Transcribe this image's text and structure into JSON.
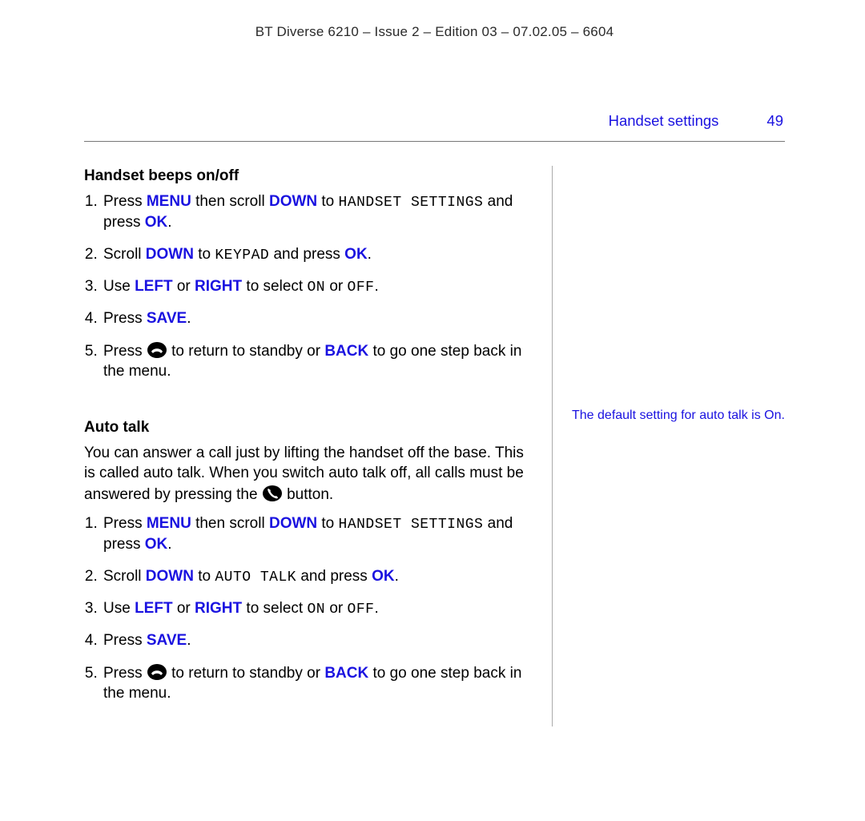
{
  "doc_header": "BT Diverse 6210 – Issue 2 – Edition 03 – 07.02.05 – 6604",
  "running_header": {
    "title": "Handset settings",
    "page": "49"
  },
  "sections": {
    "beeps": {
      "heading": "Handset beeps on/off",
      "step1": {
        "t1": "Press ",
        "kw1": "MENU",
        "t2": " then scroll ",
        "kw2": "DOWN",
        "t3": " to ",
        "mono": "HANDSET SETTINGS",
        "t4": " and press ",
        "kw3": "OK",
        "t5": "."
      },
      "step2": {
        "t1": "Scroll ",
        "kw1": "DOWN",
        "t2": " to ",
        "mono": "KEYPAD",
        "t3": " and press ",
        "kw2": "OK",
        "t4": "."
      },
      "step3": {
        "t1": "Use ",
        "kw1": "LEFT",
        "t2": " or ",
        "kw2": "RIGHT",
        "t3": " to select ",
        "mono1": "ON",
        "t4": " or ",
        "mono2": "OFF",
        "t5": "."
      },
      "step4": {
        "t1": "Press ",
        "kw1": "SAVE",
        "t2": "."
      },
      "step5": {
        "t1": "Press ",
        "t2": " to return to standby or ",
        "kw1": "BACK",
        "t3": " to go one step back in the menu."
      }
    },
    "auto": {
      "heading": "Auto talk",
      "intro": {
        "t1": "You can answer a call just by lifting the handset off the base. This is called auto talk. When you switch auto talk off, all calls must be answered by pressing the ",
        "t2": " button."
      },
      "step1": {
        "t1": "Press ",
        "kw1": "MENU",
        "t2": " then scroll ",
        "kw2": "DOWN",
        "t3": " to ",
        "mono": "HANDSET SETTINGS",
        "t4": " and press ",
        "kw3": "OK",
        "t5": "."
      },
      "step2": {
        "t1": "Scroll ",
        "kw1": "DOWN",
        "t2": " to ",
        "mono": "AUTO TALK",
        "t3": " and press ",
        "kw2": "OK",
        "t4": "."
      },
      "step3": {
        "t1": "Use ",
        "kw1": "LEFT",
        "t2": " or ",
        "kw2": "RIGHT",
        "t3": " to select ",
        "mono1": "ON",
        "t4": " or ",
        "mono2": "OFF",
        "t5": "."
      },
      "step4": {
        "t1": "Press ",
        "kw1": "SAVE",
        "t2": "."
      },
      "step5": {
        "t1": "Press ",
        "t2": " to return to standby or ",
        "kw1": "BACK",
        "t3": " to go one step back in the menu."
      }
    }
  },
  "side_note": "The default setting for auto talk is On."
}
